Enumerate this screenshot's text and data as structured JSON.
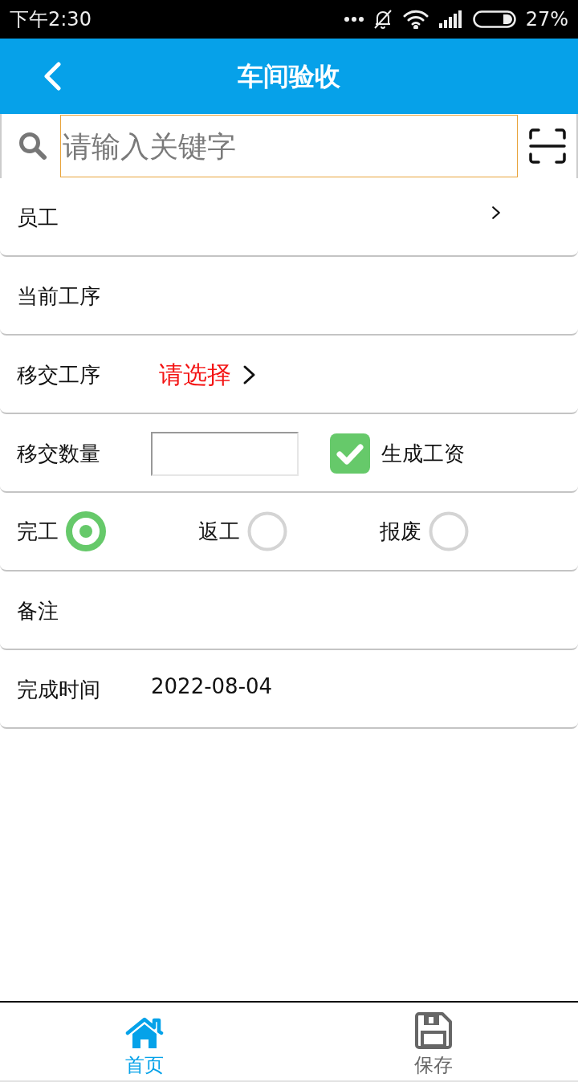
{
  "status_bar": {
    "time": "下午2:30",
    "battery": "27%"
  },
  "header": {
    "title": "车间验收"
  },
  "search": {
    "placeholder": "请输入关键字"
  },
  "form": {
    "rows": [
      {
        "kind": "link",
        "label": "员工"
      },
      {
        "kind": "plain",
        "label": "当前工序"
      },
      {
        "kind": "select",
        "label": "移交工序",
        "value": "请选择"
      },
      {
        "kind": "quantity",
        "label": "移交数量",
        "checkbox": {
          "label": "生成工资",
          "checked": true
        }
      },
      {
        "kind": "radios",
        "options": [
          {
            "label": "完工",
            "selected": true
          },
          {
            "label": "返工",
            "selected": false
          },
          {
            "label": "报废",
            "selected": false
          }
        ]
      },
      {
        "kind": "plain",
        "label": "备注"
      },
      {
        "kind": "value",
        "label": "完成时间",
        "value": "2022-08-04"
      }
    ]
  },
  "bottom_nav": [
    {
      "kind": "home",
      "label": "首页",
      "selected": true
    },
    {
      "kind": "save",
      "label": "保存",
      "selected": false
    }
  ]
}
